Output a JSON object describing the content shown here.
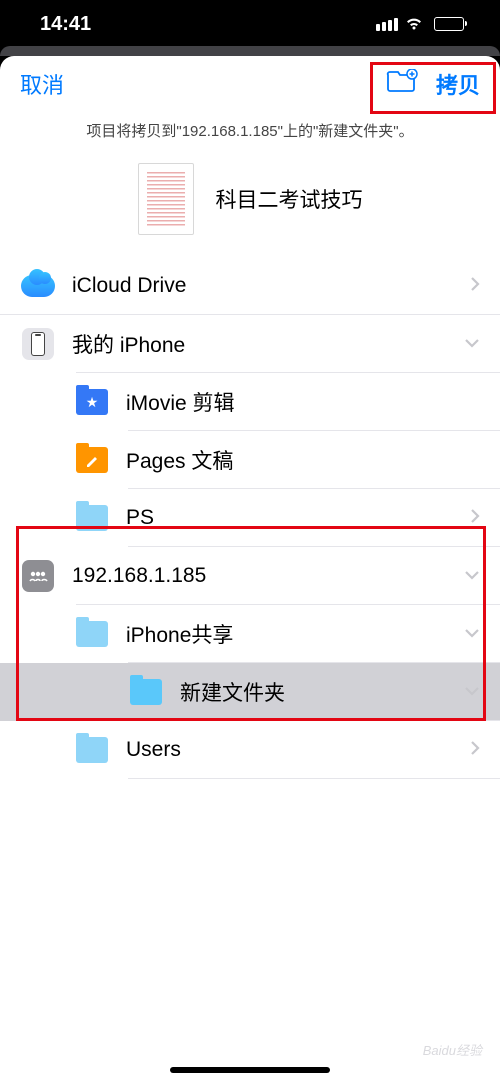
{
  "status": {
    "time": "14:41"
  },
  "nav": {
    "cancel": "取消",
    "copy": "拷贝"
  },
  "info": {
    "message": "项目将拷贝到\"192.168.1.185\"上的\"新建文件夹\"。"
  },
  "preview": {
    "filename": "科目二考试技巧"
  },
  "locations": [
    {
      "label": "iCloud Drive",
      "chevron": "right",
      "indent": 0,
      "icon": "icloud"
    },
    {
      "label": "我的 iPhone",
      "chevron": "down",
      "indent": 0,
      "icon": "iphone"
    },
    {
      "label": "iMovie 剪辑",
      "chevron": null,
      "indent": 1,
      "icon": "folder-imovie"
    },
    {
      "label": "Pages 文稿",
      "chevron": null,
      "indent": 1,
      "icon": "folder-pages"
    },
    {
      "label": "PS",
      "chevron": "right",
      "indent": 1,
      "icon": "folder-light"
    },
    {
      "label": "192.168.1.185",
      "chevron": "down",
      "indent": 0,
      "icon": "server"
    },
    {
      "label": "iPhone共享",
      "chevron": "down",
      "indent": 1,
      "icon": "folder-light"
    },
    {
      "label": "新建文件夹",
      "chevron": "down",
      "indent": 2,
      "icon": "folder-blue",
      "selected": true
    },
    {
      "label": "Users",
      "chevron": "right",
      "indent": 1,
      "icon": "folder-light"
    }
  ],
  "watermark": "Baidu经验"
}
